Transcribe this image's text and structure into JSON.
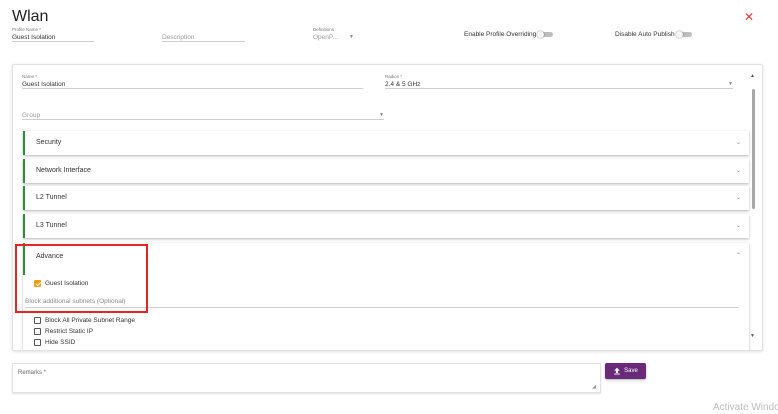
{
  "header": {
    "title": "Wlan",
    "close_icon": "close-icon",
    "close_glyph": "✕",
    "close_color": "#e53935"
  },
  "top_form": {
    "profile_name": {
      "label": "Profile Name *",
      "value": "Guest Isolation"
    },
    "description": {
      "placeholder": "Description"
    },
    "definitions": {
      "label": "Definitions",
      "value": "OpenP..."
    },
    "enable_profile_overriding": {
      "label": "Enable Profile Overriding",
      "on": false
    },
    "disable_auto_publish": {
      "label": "Disable Auto Publish",
      "on": false
    }
  },
  "panel": {
    "name": {
      "label": "Name *",
      "value": "Guest Isolation"
    },
    "radios": {
      "label": "Radios *",
      "value": "2.4 & 5 GHz"
    },
    "group": {
      "placeholder": "Group"
    },
    "sections": [
      {
        "label": "Security",
        "expanded": false
      },
      {
        "label": "Network Interface",
        "expanded": false
      },
      {
        "label": "L2 Tunnel",
        "expanded": false
      },
      {
        "label": "L3 Tunnel",
        "expanded": false
      }
    ],
    "advance": {
      "label": "Advance",
      "expanded": true,
      "guest_isolation": {
        "label": "Guest Isolation",
        "checked": true
      },
      "block_subnets": {
        "placeholder": "Block additional subnets (Optional)"
      },
      "block_private": {
        "label": "Block All Private Subnet Range",
        "checked": false
      },
      "restrict_static_ip": {
        "label": "Restrict Static IP",
        "checked": false
      },
      "hide_ssid": {
        "label": "Hide SSID",
        "checked": false
      }
    }
  },
  "remarks": {
    "label": "Remarks *"
  },
  "save": {
    "label": "Save",
    "icon": "upload-icon"
  },
  "watermark": "Activate Windo",
  "colors": {
    "accent_green": "#2e8b3d",
    "checkbox_orange": "#f39c12",
    "save_purple": "#6a2a7a",
    "highlight_red": "#e32626"
  }
}
